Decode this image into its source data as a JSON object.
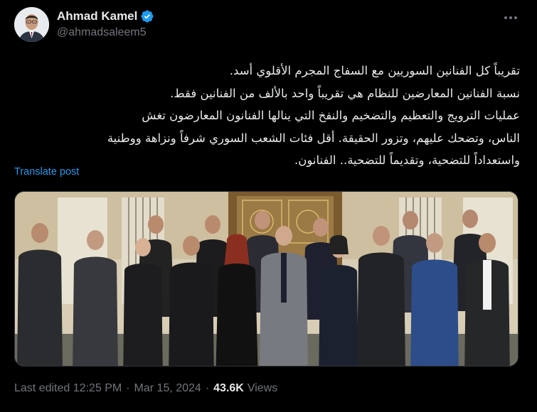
{
  "author": {
    "display_name": "Ahmad Kamel",
    "handle": "@ahmadsaleem5",
    "verified_color": "#1d9bf0"
  },
  "post": {
    "lines": [
      "تقريباً كل الفنانين السوريين مع السفاج المجرم الأقلوي أسد.",
      "نسبة الفنانين المعارضين للنظام هي تقريباً واحد بالألف من الفنانين فقط.",
      "عمليات الترويج والتعظيم والتضخيم والنفخ التي ينالها الفنانون المعارضون تغش",
      "الناس، وتضحك عليهم، وتزور الحقيقة. أقل فئات الشعب السوري شرفاً ونزاهة ووطنية",
      "واستعداداً للتضحية، وتقديماً للتضحية.. الفنانون."
    ],
    "translate_label": "Translate post",
    "photo_icon": "group-photo"
  },
  "meta": {
    "edited": "Last edited 12:25 PM",
    "separator": "·",
    "date": "Mar 15, 2024",
    "views_count": "43.6K",
    "views_label": "Views"
  },
  "colors": {
    "background": "#000000",
    "text": "#e7e9ea",
    "secondary": "#71767b",
    "accent": "#1d9bf0"
  }
}
